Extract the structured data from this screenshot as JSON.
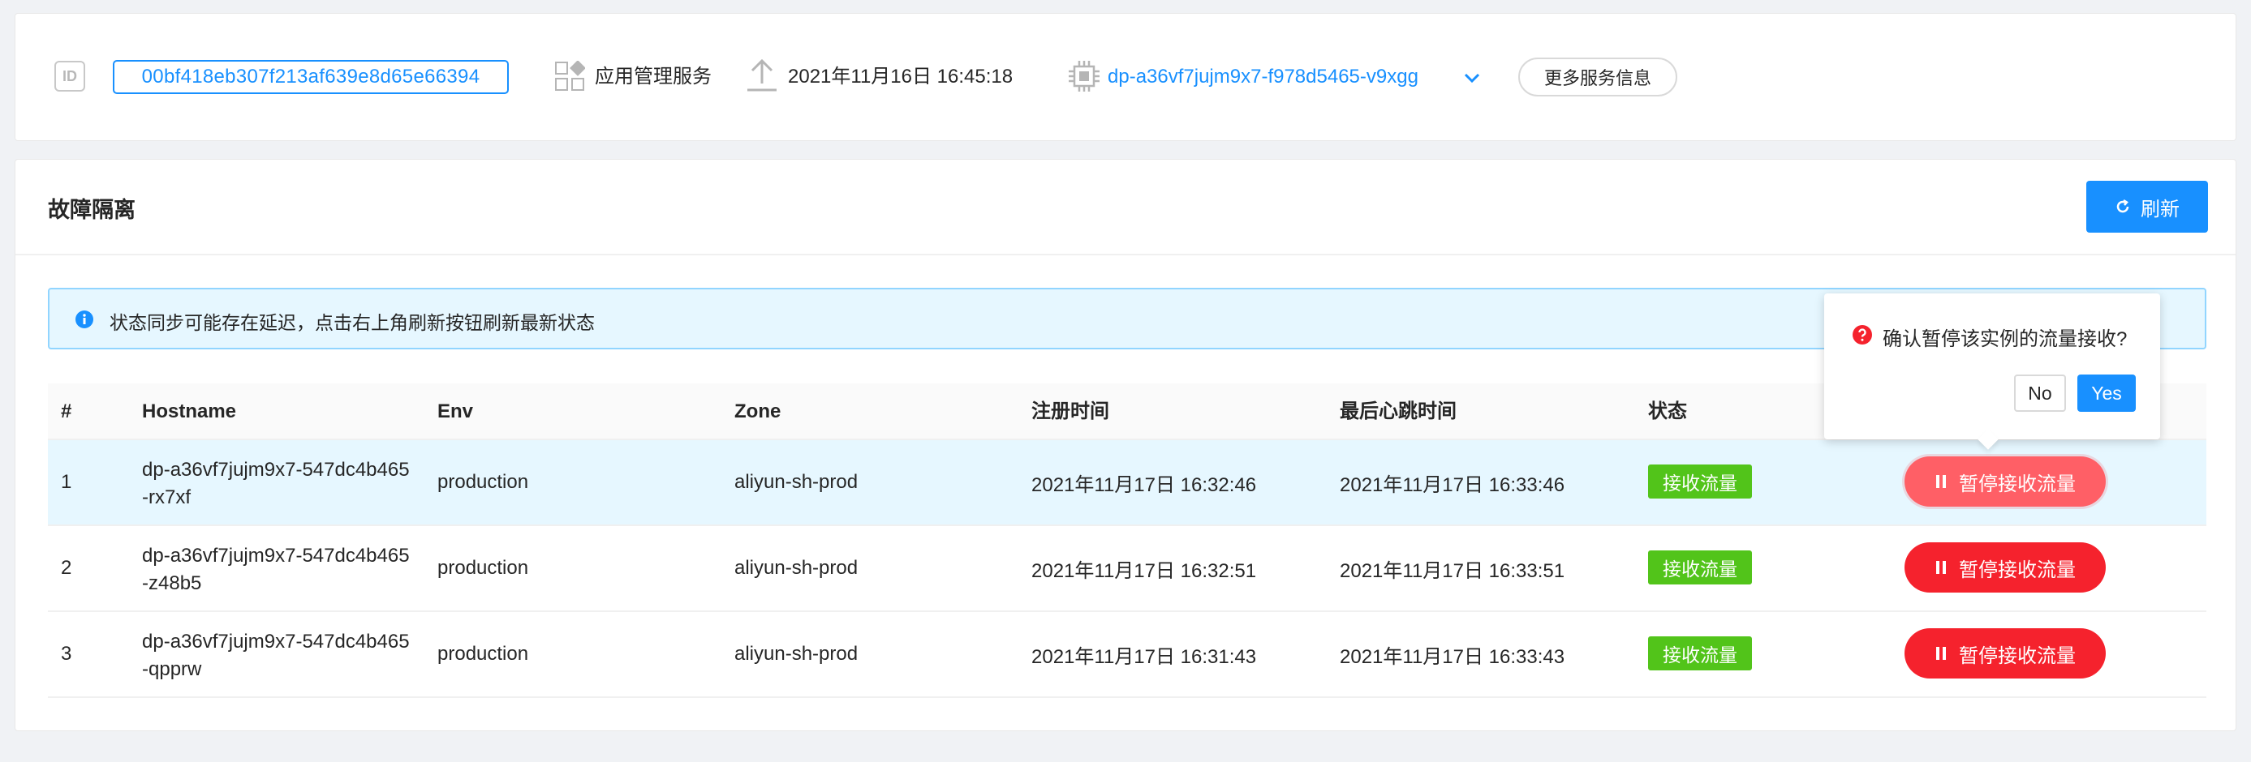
{
  "info_bar": {
    "id_label": "ID",
    "id_value": "00bf418eb307f213af639e8d65e66394",
    "service_name": "应用管理服务",
    "deploy_time": "2021年11月16日 16:45:18",
    "instance_group": "dp-a36vf7jujm9x7-f978d5465-v9xgg",
    "more_button": "更多服务信息"
  },
  "section": {
    "title": "故障隔离",
    "refresh_button": "刷新"
  },
  "alert": {
    "text": "状态同步可能存在延迟，点击右上角刷新按钮刷新最新状态"
  },
  "table": {
    "columns": [
      "#",
      "Hostname",
      "Env",
      "Zone",
      "注册时间",
      "最后心跳时间",
      "状态"
    ],
    "rows": [
      {
        "index": "1",
        "hostname": "dp-a36vf7jujm9x7-547dc4b465-rx7xf",
        "env": "production",
        "zone": "aliyun-sh-prod",
        "registered": "2021年11月17日 16:32:46",
        "heartbeat": "2021年11月17日 16:33:46",
        "status": "接收流量",
        "action": "暂停接收流量"
      },
      {
        "index": "2",
        "hostname": "dp-a36vf7jujm9x7-547dc4b465-z48b5",
        "env": "production",
        "zone": "aliyun-sh-prod",
        "registered": "2021年11月17日 16:32:51",
        "heartbeat": "2021年11月17日 16:33:51",
        "status": "接收流量",
        "action": "暂停接收流量"
      },
      {
        "index": "3",
        "hostname": "dp-a36vf7jujm9x7-547dc4b465-qpprw",
        "env": "production",
        "zone": "aliyun-sh-prod",
        "registered": "2021年11月17日 16:31:43",
        "heartbeat": "2021年11月17日 16:33:43",
        "status": "接收流量",
        "action": "暂停接收流量"
      }
    ]
  },
  "popconfirm": {
    "message": "确认暂停该实例的流量接收?",
    "no_label": "No",
    "yes_label": "Yes"
  },
  "icons": {
    "id": "id-badge-icon",
    "service": "app-grid-icon",
    "deploy": "upload-icon",
    "instance": "chip-icon",
    "dropdown": "chevron-down-icon",
    "refresh": "reload-icon",
    "info": "info-circle-icon",
    "pause": "pause-icon",
    "question": "question-circle-icon"
  },
  "colors": {
    "primary": "#1890ff",
    "danger": "#f5222d",
    "success": "#52c41a",
    "alert_bg": "#e6f7ff",
    "alert_border": "#91d5ff",
    "question": "#f5222d"
  }
}
